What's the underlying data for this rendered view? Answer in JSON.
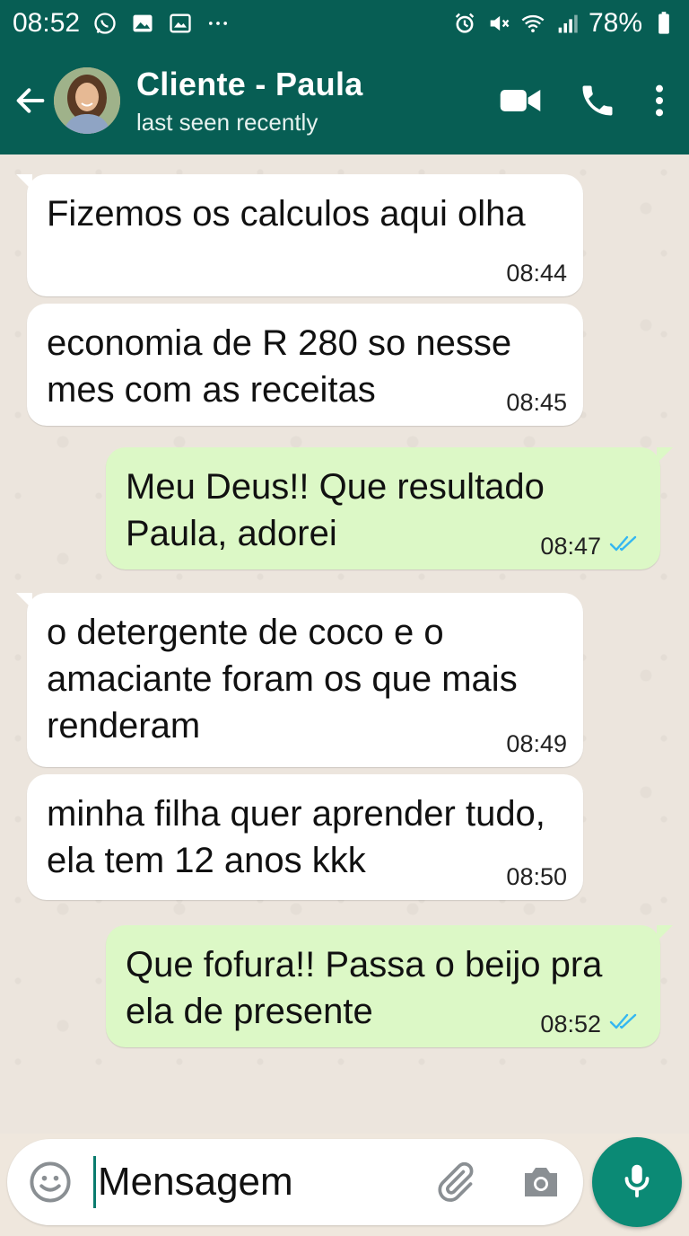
{
  "status_bar": {
    "time": "08:52",
    "battery": "78%",
    "icons": [
      "whatsapp-icon",
      "image-icon",
      "gallery-icon",
      "more-dots-icon",
      "alarm-icon",
      "mute-icon",
      "wifi-icon",
      "signal-icon",
      "battery-icon"
    ]
  },
  "header": {
    "contact_name": "Cliente - Paula",
    "status": "last seen recently",
    "icons": [
      "back-arrow-icon",
      "video-call-icon",
      "phone-icon",
      "menu-dots-icon"
    ]
  },
  "messages": [
    {
      "direction": "in",
      "text": "Fizemos os calculos aqui olha",
      "time": "08:44"
    },
    {
      "direction": "in",
      "text": "economia de R 280 so nesse mes com as receitas",
      "time": "08:45"
    },
    {
      "direction": "out",
      "text": "Meu Deus!! Que resultado Paula, adorei",
      "time": "08:47",
      "read": true
    },
    {
      "direction": "in",
      "text": "o detergente de coco e o amaciante foram os que mais renderam",
      "time": "08:49"
    },
    {
      "direction": "in",
      "text": "minha filha quer aprender tudo, ela tem 12 anos kkk",
      "time": "08:50"
    },
    {
      "direction": "out",
      "text": "Que fofura!! Passa o beijo pra ela de presente",
      "time": "08:52",
      "read": true
    }
  ],
  "composer": {
    "placeholder": "Mensagem",
    "icons": [
      "emoji-icon",
      "attach-icon",
      "camera-icon",
      "mic-icon"
    ]
  },
  "colors": {
    "header_bg": "#075e54",
    "outgoing_bubble": "#dcf8c6",
    "incoming_bubble": "#ffffff",
    "read_ticks": "#34b7f1",
    "mic_button": "#0b8a75"
  }
}
